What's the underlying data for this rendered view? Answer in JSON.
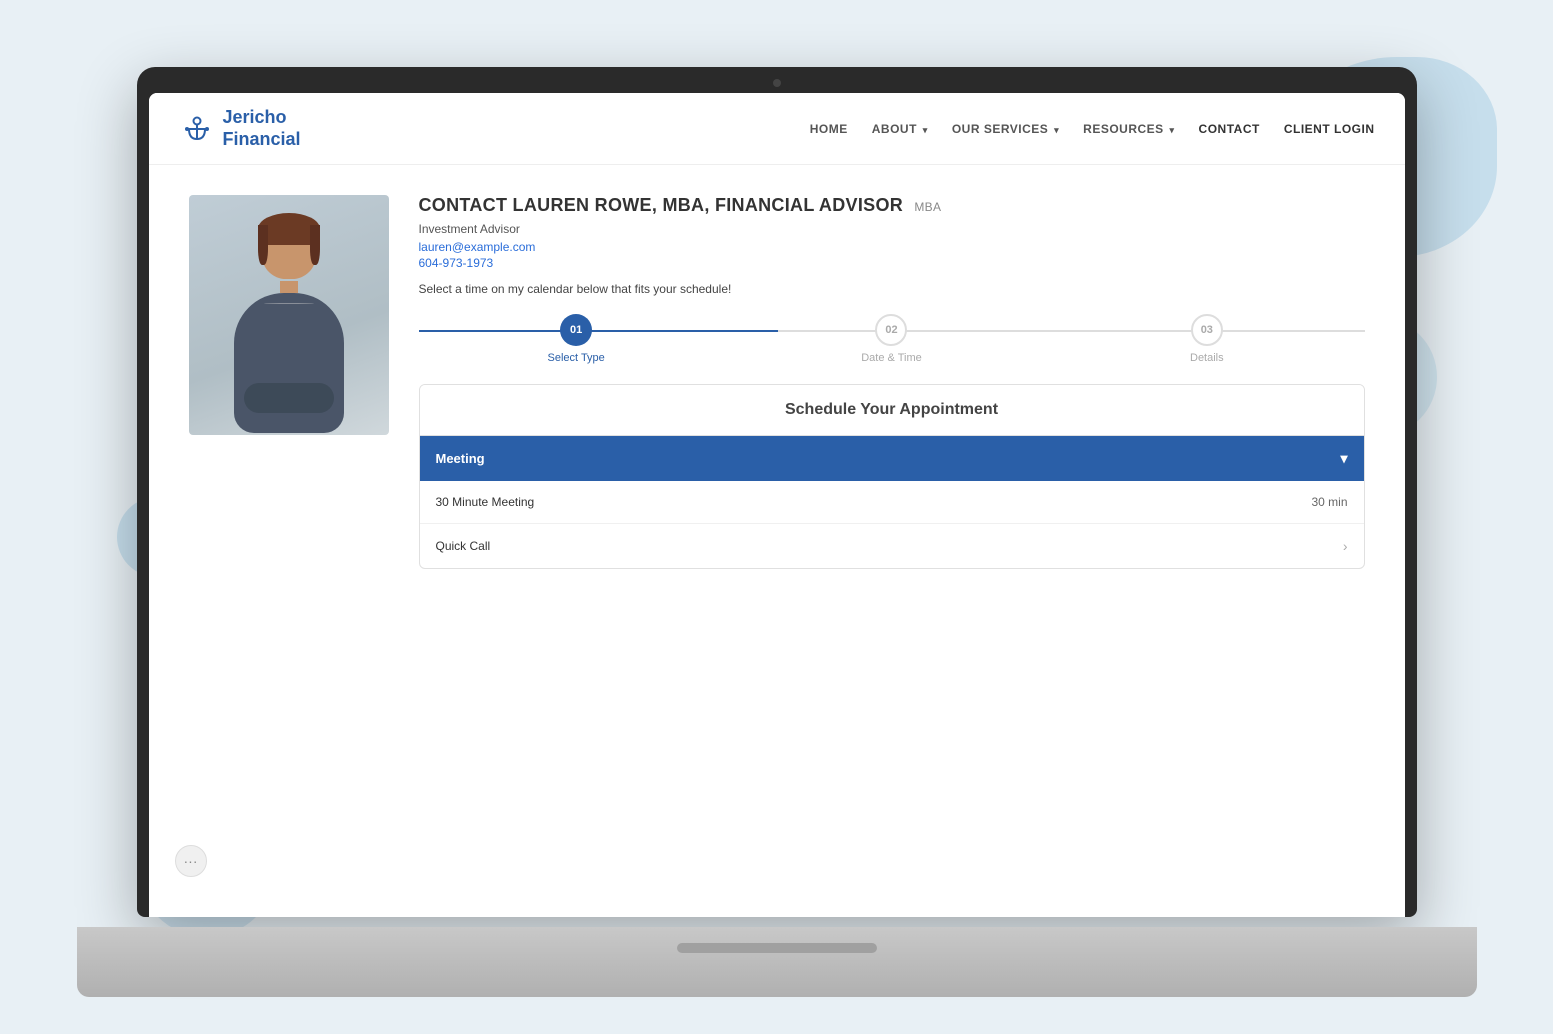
{
  "scene": {
    "background_color": "#dce8f0"
  },
  "nav": {
    "logo_text_line1": "Jericho",
    "logo_text_line2": "Financial",
    "links": [
      {
        "label": "HOME",
        "id": "home",
        "has_dropdown": false
      },
      {
        "label": "ABOUT",
        "id": "about",
        "has_dropdown": true
      },
      {
        "label": "OUR SERVICES",
        "id": "our-services",
        "has_dropdown": true
      },
      {
        "label": "RESOURCES",
        "id": "resources",
        "has_dropdown": true
      },
      {
        "label": "CONTACT",
        "id": "contact",
        "has_dropdown": false
      },
      {
        "label": "CLIENT LOGIN",
        "id": "client-login",
        "has_dropdown": false
      }
    ]
  },
  "advisor": {
    "page_title": "CONTACT LAUREN ROWE, MBA, FINANCIAL ADVISOR",
    "mba_badge": "MBA",
    "role": "Investment Advisor",
    "email": "lauren@example.com",
    "phone": "604-973-1973",
    "schedule_prompt": "Select a time on my calendar below that fits your schedule!"
  },
  "stepper": {
    "steps": [
      {
        "number": "01",
        "label": "Select Type",
        "active": true
      },
      {
        "number": "02",
        "label": "Date & Time",
        "active": false
      },
      {
        "number": "03",
        "label": "Details",
        "active": false
      }
    ]
  },
  "appointment": {
    "header": "Schedule Your Appointment",
    "meeting_section_label": "Meeting",
    "chevron_icon": "▾",
    "options": [
      {
        "label": "30 Minute Meeting",
        "duration": "30 min",
        "has_arrow": false
      },
      {
        "label": "Quick Call",
        "duration": "",
        "has_arrow": true
      }
    ]
  },
  "ui": {
    "three_dots": "···"
  }
}
